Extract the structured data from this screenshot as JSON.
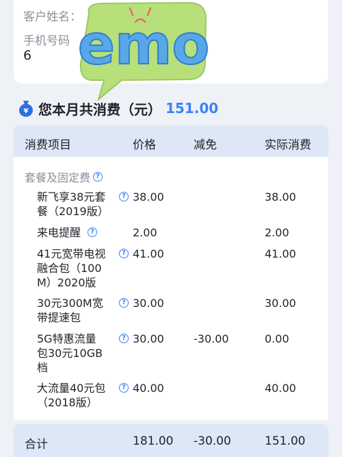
{
  "customer": {
    "name_label": "客户姓名：",
    "phone_label": "手机号码",
    "phone_value": "6"
  },
  "sticker": {
    "text": "emo"
  },
  "summary": {
    "text": "您本月共消费（元）",
    "amount": "151.00"
  },
  "table": {
    "headers": [
      "消费项目",
      "价格",
      "减免",
      "实际消费"
    ],
    "group_title": "套餐及固定费",
    "rows": [
      {
        "name_lines": [
          "新飞享38元套",
          "餐（2019版）"
        ],
        "price": "38.00",
        "discount": "",
        "actual": "38.00"
      },
      {
        "name_lines": [
          "来电提醒"
        ],
        "price": "2.00",
        "discount": "",
        "actual": "2.00"
      },
      {
        "name_lines": [
          "41元宽带电视",
          "融合包（100",
          "M）2020版"
        ],
        "price": "41.00",
        "discount": "",
        "actual": "41.00"
      },
      {
        "name_lines": [
          "30元300M宽",
          "带提速包"
        ],
        "price": "30.00",
        "discount": "",
        "actual": "30.00"
      },
      {
        "name_lines": [
          "5G特惠流量",
          "包30元10GB",
          "档"
        ],
        "price": "30.00",
        "discount": "-30.00",
        "actual": "0.00"
      },
      {
        "name_lines": [
          "大流量40元包",
          "（2018版）"
        ],
        "price": "40.00",
        "discount": "",
        "actual": "40.00"
      }
    ]
  },
  "total": {
    "label": "合计",
    "price": "181.00",
    "discount": "-30.00",
    "actual": "151.00"
  },
  "colors": {
    "accent": "#3b82f6",
    "header_bg": "#dde7f6",
    "sticker_green": "#b7df7a",
    "sticker_letters": "#5aa7e8"
  }
}
